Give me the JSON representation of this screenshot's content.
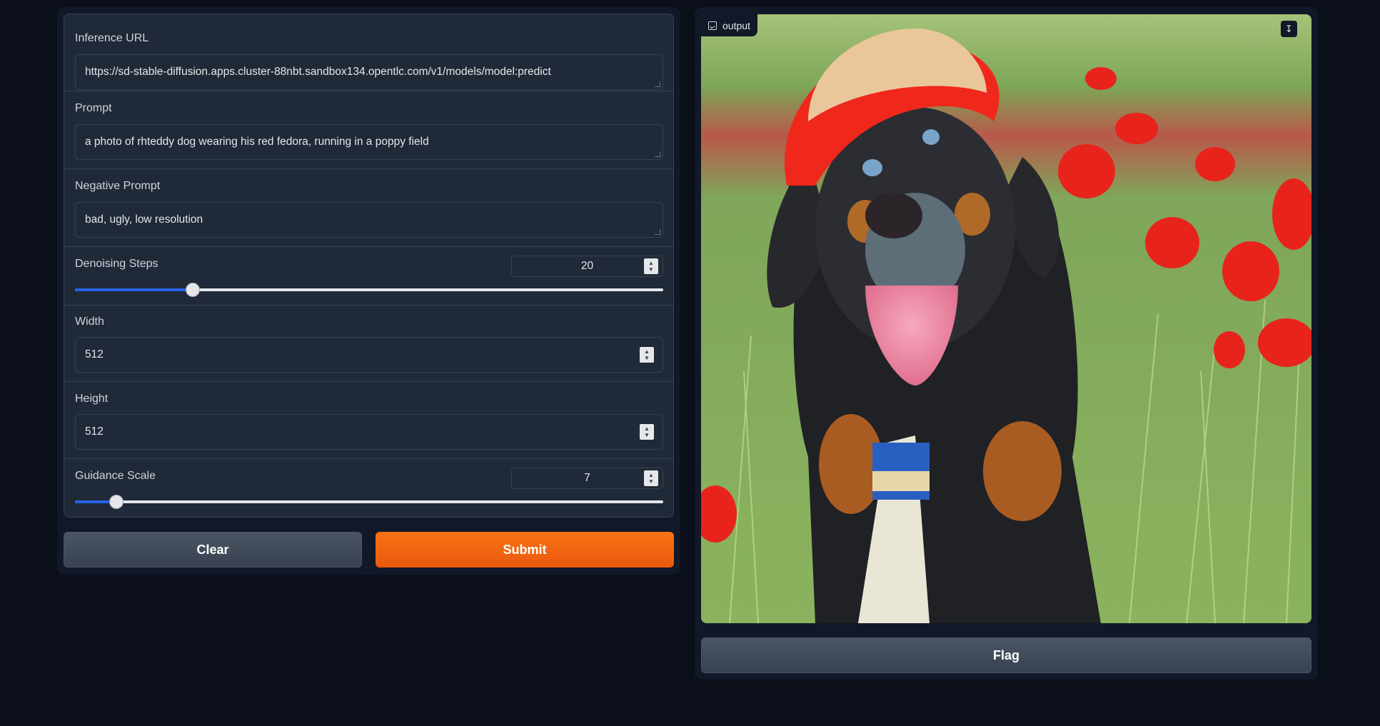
{
  "form": {
    "inference_url": {
      "label": "Inference URL",
      "value": "https://sd-stable-diffusion.apps.cluster-88nbt.sandbox134.opentlc.com/v1/models/model:predict"
    },
    "prompt": {
      "label": "Prompt",
      "value": "a photo of rhteddy dog wearing his red fedora, running in a poppy field"
    },
    "negative_prompt": {
      "label": "Negative Prompt",
      "value": "bad, ugly, low resolution"
    },
    "denoising_steps": {
      "label": "Denoising Steps",
      "value": "20",
      "fraction": 0.2
    },
    "width": {
      "label": "Width",
      "value": "512"
    },
    "height": {
      "label": "Height",
      "value": "512"
    },
    "guidance_scale": {
      "label": "Guidance Scale",
      "value": "7",
      "fraction": 0.07
    }
  },
  "buttons": {
    "clear": "Clear",
    "submit": "Submit",
    "flag": "Flag"
  },
  "output": {
    "label": "output",
    "image_icon": "image-icon",
    "download_icon": "download-icon"
  },
  "colors": {
    "accent": "#2563eb",
    "submit": "#f97316",
    "background": "#0b0f19",
    "panel": "#1f2937"
  }
}
